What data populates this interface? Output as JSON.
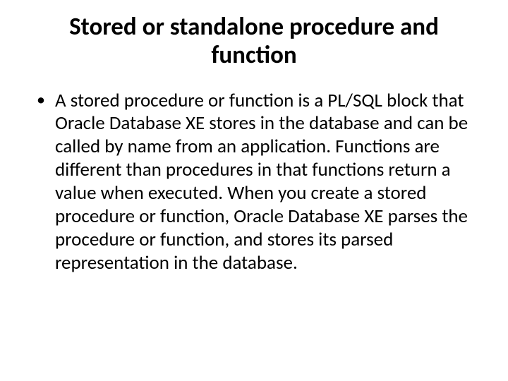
{
  "title": "Stored or standalone procedure and function",
  "bullets": [
    "A stored procedure or function is a PL/SQL block that Oracle Database XE stores in the database and can be called by name from an application. Functions are different than procedures in that functions return a value when executed. When you create a stored procedure or function, Oracle Database XE parses the procedure or function, and stores its parsed representation in the database."
  ]
}
